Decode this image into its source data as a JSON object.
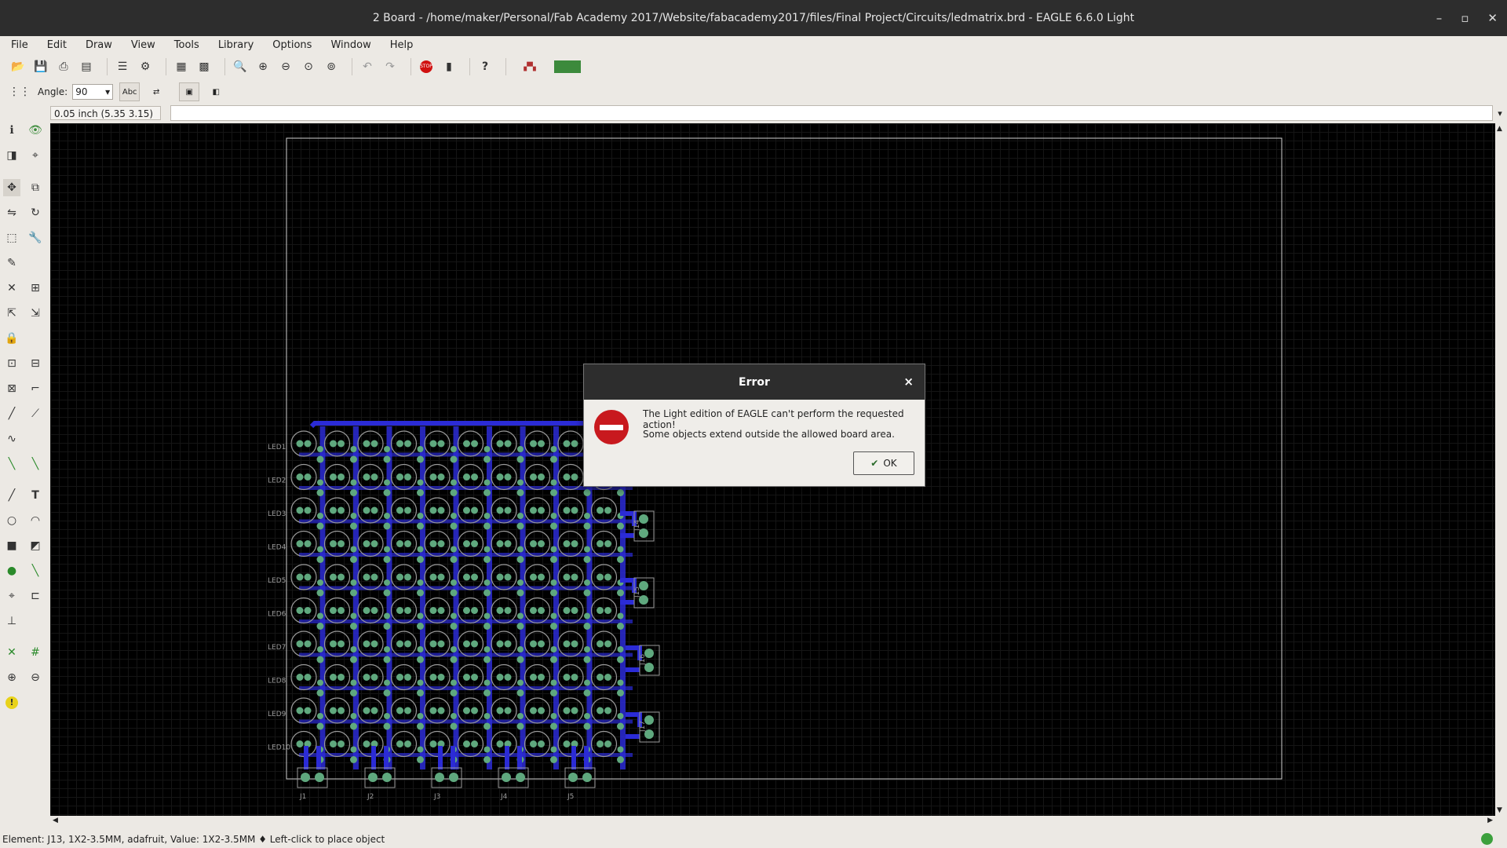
{
  "window": {
    "title": "2 Board - /home/maker/Personal/Fab Academy 2017/Website/fabacademy2017/files/Final Project/Circuits/ledmatrix.brd - EAGLE 6.6.0 Light",
    "minimize": "–",
    "maximize": "▫",
    "close": "✕"
  },
  "menu": {
    "file": "File",
    "edit": "Edit",
    "draw": "Draw",
    "view": "View",
    "tools": "Tools",
    "library": "Library",
    "options": "Options",
    "window": "Window",
    "help": "Help"
  },
  "toolbar": {
    "icons": [
      "open-icon",
      "save-icon",
      "print-icon",
      "cam-icon",
      "script-icon",
      "ulp-icon",
      "schematic-icon",
      "board-icon",
      "zoom-fit-icon",
      "zoom-in-icon",
      "zoom-out-icon",
      "zoom-select-icon",
      "zoom-area-icon",
      "undo-icon",
      "redo-icon",
      "stop-icon",
      "go-icon",
      "help-icon",
      "designlink-icon",
      "pcbquote-icon"
    ]
  },
  "params": {
    "angle_label": "Angle:",
    "angle_value": "90"
  },
  "coords": {
    "readout": "0.05 inch (5.35 3.15)"
  },
  "board": {
    "row_labels": [
      "LED1",
      "LED2",
      "LED3",
      "LED4",
      "LED5",
      "LED6",
      "LED7",
      "LED8",
      "LED9",
      "LED10"
    ],
    "bottom_connectors": [
      "J1",
      "J2",
      "J3",
      "J4",
      "J5"
    ],
    "side_connectors": [
      "J14",
      "J15",
      "J16",
      "J17"
    ],
    "colors": {
      "trace": "#2b2bd6",
      "pad": "#5fa87e",
      "outline": "#cfcfcf",
      "silk": "#9a9a9a",
      "background": "#000000"
    }
  },
  "dialog": {
    "title": "Error",
    "close": "×",
    "message1": "The Light edition of EAGLE can't perform the requested action!",
    "message2": "Some objects extend outside the allowed board area.",
    "ok": "OK"
  },
  "status": {
    "text": "Element: J13, 1X2-3.5MM, adafruit, Value: 1X2-3.5MM  ♦ Left-click to place object"
  }
}
